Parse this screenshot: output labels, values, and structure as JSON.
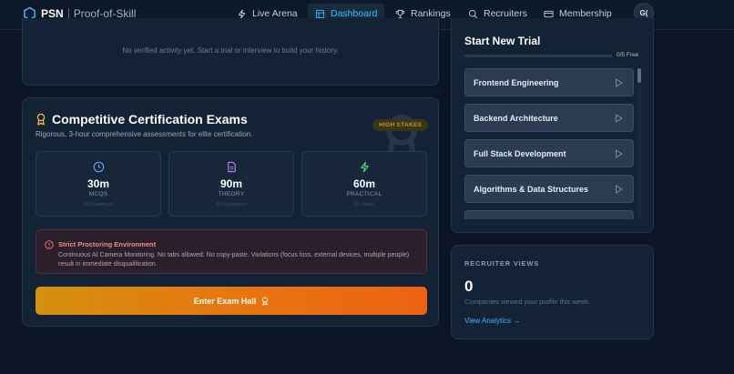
{
  "nav": {
    "brand": "PSN",
    "brand_sub": "Proof-of-Skill",
    "items": [
      {
        "label": "Live Arena",
        "icon": "bolt-icon"
      },
      {
        "label": "Dashboard",
        "icon": "dashboard-icon",
        "active": true
      },
      {
        "label": "Rankings",
        "icon": "trophy-icon"
      },
      {
        "label": "Recruiters",
        "icon": "search-icon"
      },
      {
        "label": "Membership",
        "icon": "card-icon"
      }
    ],
    "avatar": "G("
  },
  "activity": {
    "empty_text": "No verified activity yet. Start a trial or interview to build your history."
  },
  "certification": {
    "title": "Competitive Certification Exams",
    "subtitle": "Rigorous, 3-hour comprehensive assessments for elite certification.",
    "badge": "HIGH STAKES",
    "stats": [
      {
        "value": "30m",
        "label": "MCQS",
        "count": "30 Questions",
        "icon": "clock-icon"
      },
      {
        "value": "90m",
        "label": "THEORY",
        "count": "60 Questions",
        "icon": "document-icon"
      },
      {
        "value": "60m",
        "label": "PRACTICAL",
        "count": "15 Tasks",
        "icon": "bolt-icon"
      }
    ],
    "warning_title": "Strict Proctoring Environment",
    "warning_body": "Continuous AI Camera Monitoring. No tabs allowed. No copy-paste. Violations (focus loss, external devices, multiple people) result in immediate disqualification.",
    "enter_label": "Enter Exam Hall"
  },
  "trial": {
    "title": "Start New Trial",
    "count": "0/5 Free",
    "progress": 0,
    "tracks": [
      "Frontend Engineering",
      "Backend Architecture",
      "Full Stack Development",
      "Algorithms & Data Structures",
      ""
    ]
  },
  "recruiter": {
    "label": "RECRUITER VIEWS",
    "value": "0",
    "description": "Companies viewed your profile this week.",
    "link": "View Analytics →"
  },
  "colors": {
    "accent": "#38bdf8",
    "cta_start": "#d4900f",
    "cta_end": "#ec6212",
    "warning": "#f48a8a"
  }
}
